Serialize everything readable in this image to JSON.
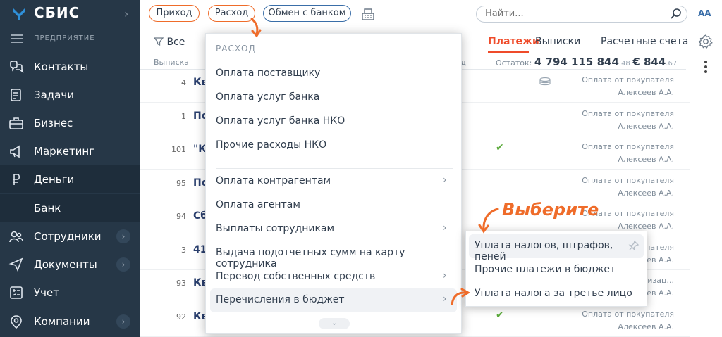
{
  "sidebar": {
    "brand": "СБИС",
    "org": "ПРЕДПРИЯТИЕ",
    "items": [
      {
        "label": "Контакты",
        "icon": "contacts-icon"
      },
      {
        "label": "Задачи",
        "icon": "tasks-icon"
      },
      {
        "label": "Бизнес",
        "icon": "business-icon"
      },
      {
        "label": "Маркетинг",
        "icon": "marketing-icon"
      },
      {
        "label": "Деньги",
        "icon": "money-icon"
      },
      {
        "label": "Сотрудники",
        "icon": "employees-icon"
      },
      {
        "label": "Документы",
        "icon": "documents-icon"
      },
      {
        "label": "Учет",
        "icon": "accounting-icon"
      },
      {
        "label": "Компании",
        "icon": "companies-icon"
      }
    ],
    "sub_item": "Банк"
  },
  "toolbar": {
    "income": "Приход",
    "expense": "Расход",
    "bank_exchange": "Обмен с банком",
    "search_placeholder": "Найти...",
    "font_size": "AA"
  },
  "filter": {
    "label": "Все"
  },
  "tabs": [
    {
      "label": "Платежи",
      "active": true
    },
    {
      "label": "Выписки"
    },
    {
      "label": "Расчетные счета"
    }
  ],
  "table": {
    "col_statement": "Выписка",
    "col_expense": "ход",
    "balance_label": "Остаток:",
    "balance_main": "4 794 115 844",
    "balance_main_kop": ".48",
    "balance_eur": "€ 844",
    "balance_eur_kop": ".67",
    "rows": [
      {
        "num": "4",
        "title": "Кв",
        "kind": "Оплата от покупателя",
        "who": "Алексеев А.А.",
        "check": false,
        "coin": true
      },
      {
        "num": "1",
        "title": "По",
        "kind": "Оплата от покупателя",
        "who": "Алексеев А.А.",
        "check": false,
        "coin": false
      },
      {
        "num": "101",
        "title": "\"К",
        "kind": "Оплата от покупателя",
        "who": "Алексеев А.А.",
        "check": true,
        "coin": false
      },
      {
        "num": "95",
        "title": "По",
        "kind": "Оплата от покупателя",
        "who": "Алексеев А.А.",
        "check": false,
        "coin": false
      },
      {
        "num": "94",
        "title": "Сб",
        "kind": "Оплата от покупателя",
        "who": "Алексеев А.А.",
        "check": false,
        "coin": false
      },
      {
        "num": "3",
        "title": "41",
        "kind": "Оплата от покупателя",
        "who": "Алексеев А.А.",
        "check": false,
        "coin": false
      },
      {
        "num": "93",
        "title": "Кв",
        "kind": "лизац...",
        "who": "Алексеев А.А.",
        "check": false,
        "coin": false
      },
      {
        "num": "92",
        "title": "Кв",
        "kind": "Оплата от покупателя",
        "who": "Алексеев А.А.",
        "check": true,
        "coin": false
      }
    ]
  },
  "dropdown": {
    "title": "РАСХОД",
    "group1": [
      "Оплата поставщику",
      "Оплата услуг банка",
      "Оплата услуг банка НКО",
      "Прочие расходы НКО"
    ],
    "group2": [
      {
        "label": "Оплата контрагентам",
        "sub": true
      },
      {
        "label": "Оплата агентам",
        "sub": false
      },
      {
        "label": "Выплаты сотрудникам",
        "sub": true
      },
      {
        "label": "Выдача подотчетных сумм на карту сотрудника",
        "sub": false
      },
      {
        "label": "Перевод собственных средств",
        "sub": true
      },
      {
        "label": "Перечисления в бюджет",
        "sub": true
      }
    ]
  },
  "submenu": {
    "items": [
      "Уплата налогов, штрафов, пеней",
      "Прочие платежи в бюджет",
      "Уплата налога за третье лицо"
    ]
  },
  "annotation": {
    "hint": "Выберите",
    "color": "#ef6c2a"
  }
}
